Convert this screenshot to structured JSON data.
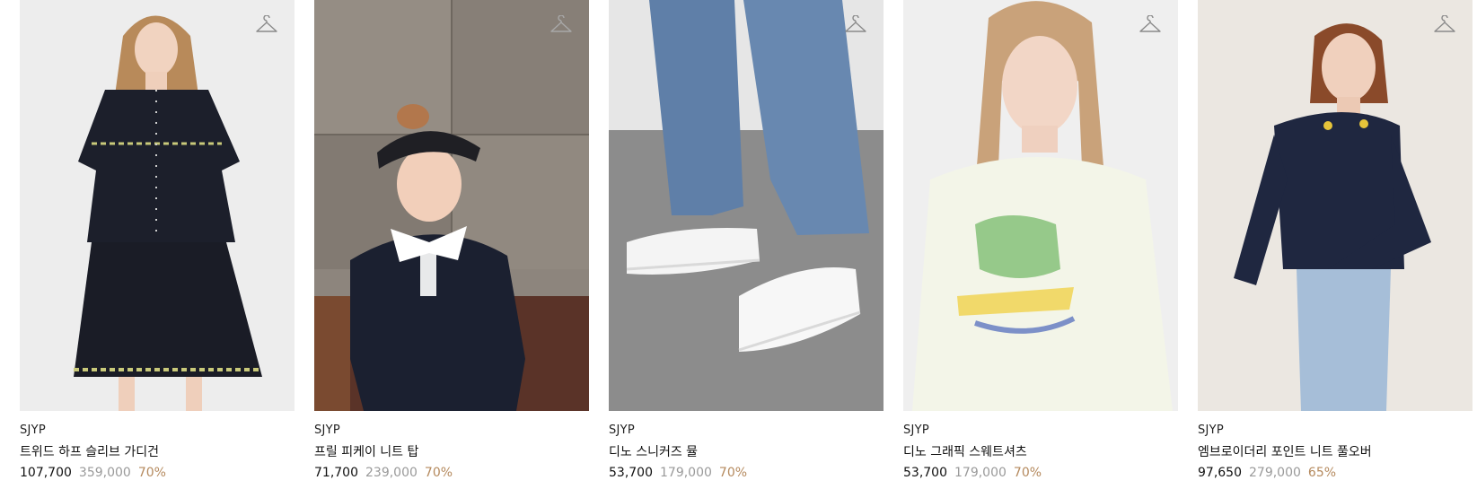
{
  "products": [
    {
      "brand": "SJYP",
      "name": "트위드 하프 슬리브 가디건",
      "sale_price": "107,700",
      "original_price": "359,000",
      "discount": "70%",
      "image": "woman-black-tweed-cardigan-skirt"
    },
    {
      "brand": "SJYP",
      "name": "프릴 피케이 니트 탑",
      "sale_price": "71,700",
      "original_price": "239,000",
      "discount": "70%",
      "image": "woman-visor-navy-frill-knit-top"
    },
    {
      "brand": "SJYP",
      "name": "디노 스니커즈 뮬",
      "sale_price": "53,700",
      "original_price": "179,000",
      "discount": "70%",
      "image": "white-sneaker-mules-jeans"
    },
    {
      "brand": "SJYP",
      "name": "디노 그래픽 스웨트셔츠",
      "sale_price": "53,700",
      "original_price": "179,000",
      "discount": "70%",
      "image": "woman-cream-dino-graphic-sweatshirt"
    },
    {
      "brand": "SJYP",
      "name": "엠브로이더리 포인트 니트 풀오버",
      "sale_price": "97,650",
      "original_price": "279,000",
      "discount": "65%",
      "image": "woman-navy-embroidered-knit-pullover"
    }
  ],
  "icons": {
    "wishlist": "hanger-icon"
  },
  "colors": {
    "discount": "#b58a5e",
    "original_price": "#9a9a9a"
  }
}
